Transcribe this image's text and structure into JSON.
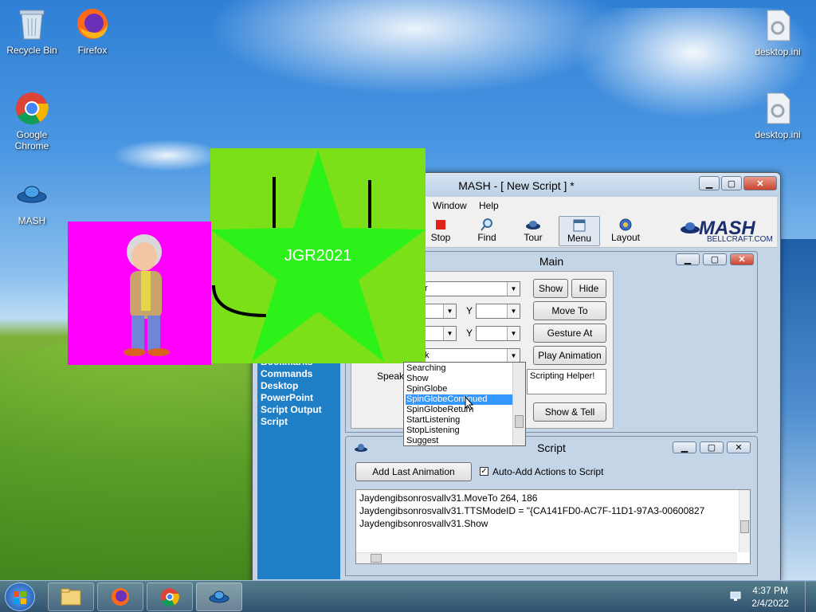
{
  "desktop": {
    "icons": [
      {
        "label": "Recycle Bin"
      },
      {
        "label": "Firefox"
      },
      {
        "label": "Google Chrome"
      },
      {
        "label": "MASH"
      },
      {
        "label": "desktop.ini"
      },
      {
        "label": "desktop.ini"
      }
    ]
  },
  "window": {
    "title": "MASH - [ New Script ] *",
    "menu": [
      "Window",
      "Help"
    ],
    "toolbar": [
      "Stop",
      "Find",
      "Tour",
      "Menu",
      "Layout"
    ],
    "logo": {
      "big": "MASH",
      "small": "BELLCRAFT.COM"
    }
  },
  "left_pane": {
    "items": [
      "Bookmarks",
      "Commands",
      "Desktop",
      "PowerPoint",
      "Script Output",
      "Script"
    ]
  },
  "main_panel": {
    "title": "Main",
    "combo1_value": "r",
    "combo_y_label": "Y",
    "combo_anim_value": "k",
    "speak_label": "Speak",
    "speak_text": "Scripting Helper!",
    "buttons": {
      "show": "Show",
      "hide": "Hide",
      "move_to": "Move To",
      "gesture_at": "Gesture At",
      "play_animation": "Play Animation",
      "show_tell": "Show & Tell"
    }
  },
  "dropdown": {
    "items": [
      "Searching",
      "Show",
      "SpinGlobe",
      "SpinGlobeContinued",
      "SpinGlobeReturn",
      "StartListening",
      "StopListening",
      "Suggest"
    ],
    "selected": "SpinGlobeContinued"
  },
  "script_panel": {
    "title": "Script",
    "add_last_button": "Add Last Animation",
    "auto_add_label": "Auto-Add Actions to Script",
    "auto_add_checked": true,
    "lines": [
      "Jaydengibsonrosvallv31.MoveTo 264, 186",
      "Jaydengibsonrosvallv31.TTSModeID = \"{CA141FD0-AC7F-11D1-97A3-00600827",
      "Jaydengibsonrosvallv31.Show"
    ]
  },
  "overlay": {
    "green_text": "JGR2021",
    "magenta_character": "agent-character"
  },
  "taskbar": {
    "time": "4:37 PM",
    "date": "2/4/2022"
  },
  "colors": {
    "left_pane_bg": "#1e7fc7",
    "green_bg": "#7ce019",
    "star": "#2df21a",
    "magenta_bg": "#ff00ff",
    "selection": "#3399ff"
  }
}
